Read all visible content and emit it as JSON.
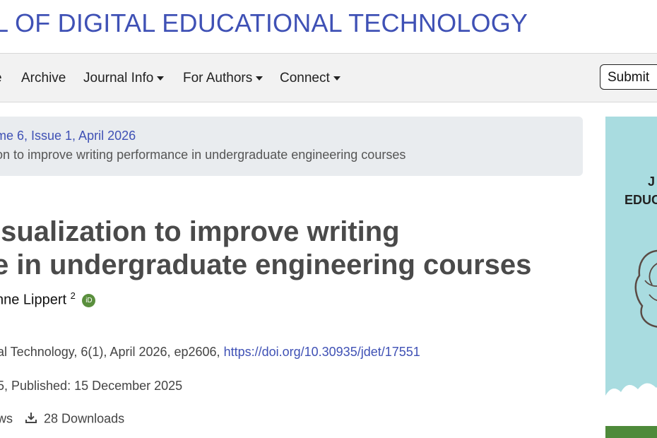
{
  "header": {
    "journal_title": "L OF DIGITAL EDUCATIONAL TECHNOLOGY"
  },
  "nav": {
    "items": [
      {
        "label": "e"
      },
      {
        "label": "Archive"
      },
      {
        "label": "Journal Info"
      },
      {
        "label": "For Authors"
      },
      {
        "label": "Connect"
      }
    ],
    "submit_label": "Submit"
  },
  "breadcrumb": {
    "issue_link": "me 6, Issue 1, April 2026",
    "current": "on to improve writing performance in undergraduate engineering courses"
  },
  "article": {
    "title_line1": "isualization to improve writing",
    "title_line2": "e in undergraduate engineering courses",
    "author": "nne Lippert",
    "author_sup": "2",
    "orcid_label": "iD",
    "citation_prefix": "al Technology, 6(1), April 2026, ep2606, ",
    "doi": "https://doi.org/10.30935/jdet/17551",
    "dates": "5, Published: 15 December 2025",
    "views_fragment": "ws",
    "downloads": "28 Downloads"
  },
  "cover": {
    "line1": "J",
    "line2": "EDUC"
  },
  "colors": {
    "link": "#3f51b5",
    "title": "#4a4a4a",
    "nav_bg": "#f2f2f2",
    "breadcrumb_bg": "#e9ecef",
    "cover_bg": "#a9dce0",
    "orcid": "#5a8f3d"
  }
}
